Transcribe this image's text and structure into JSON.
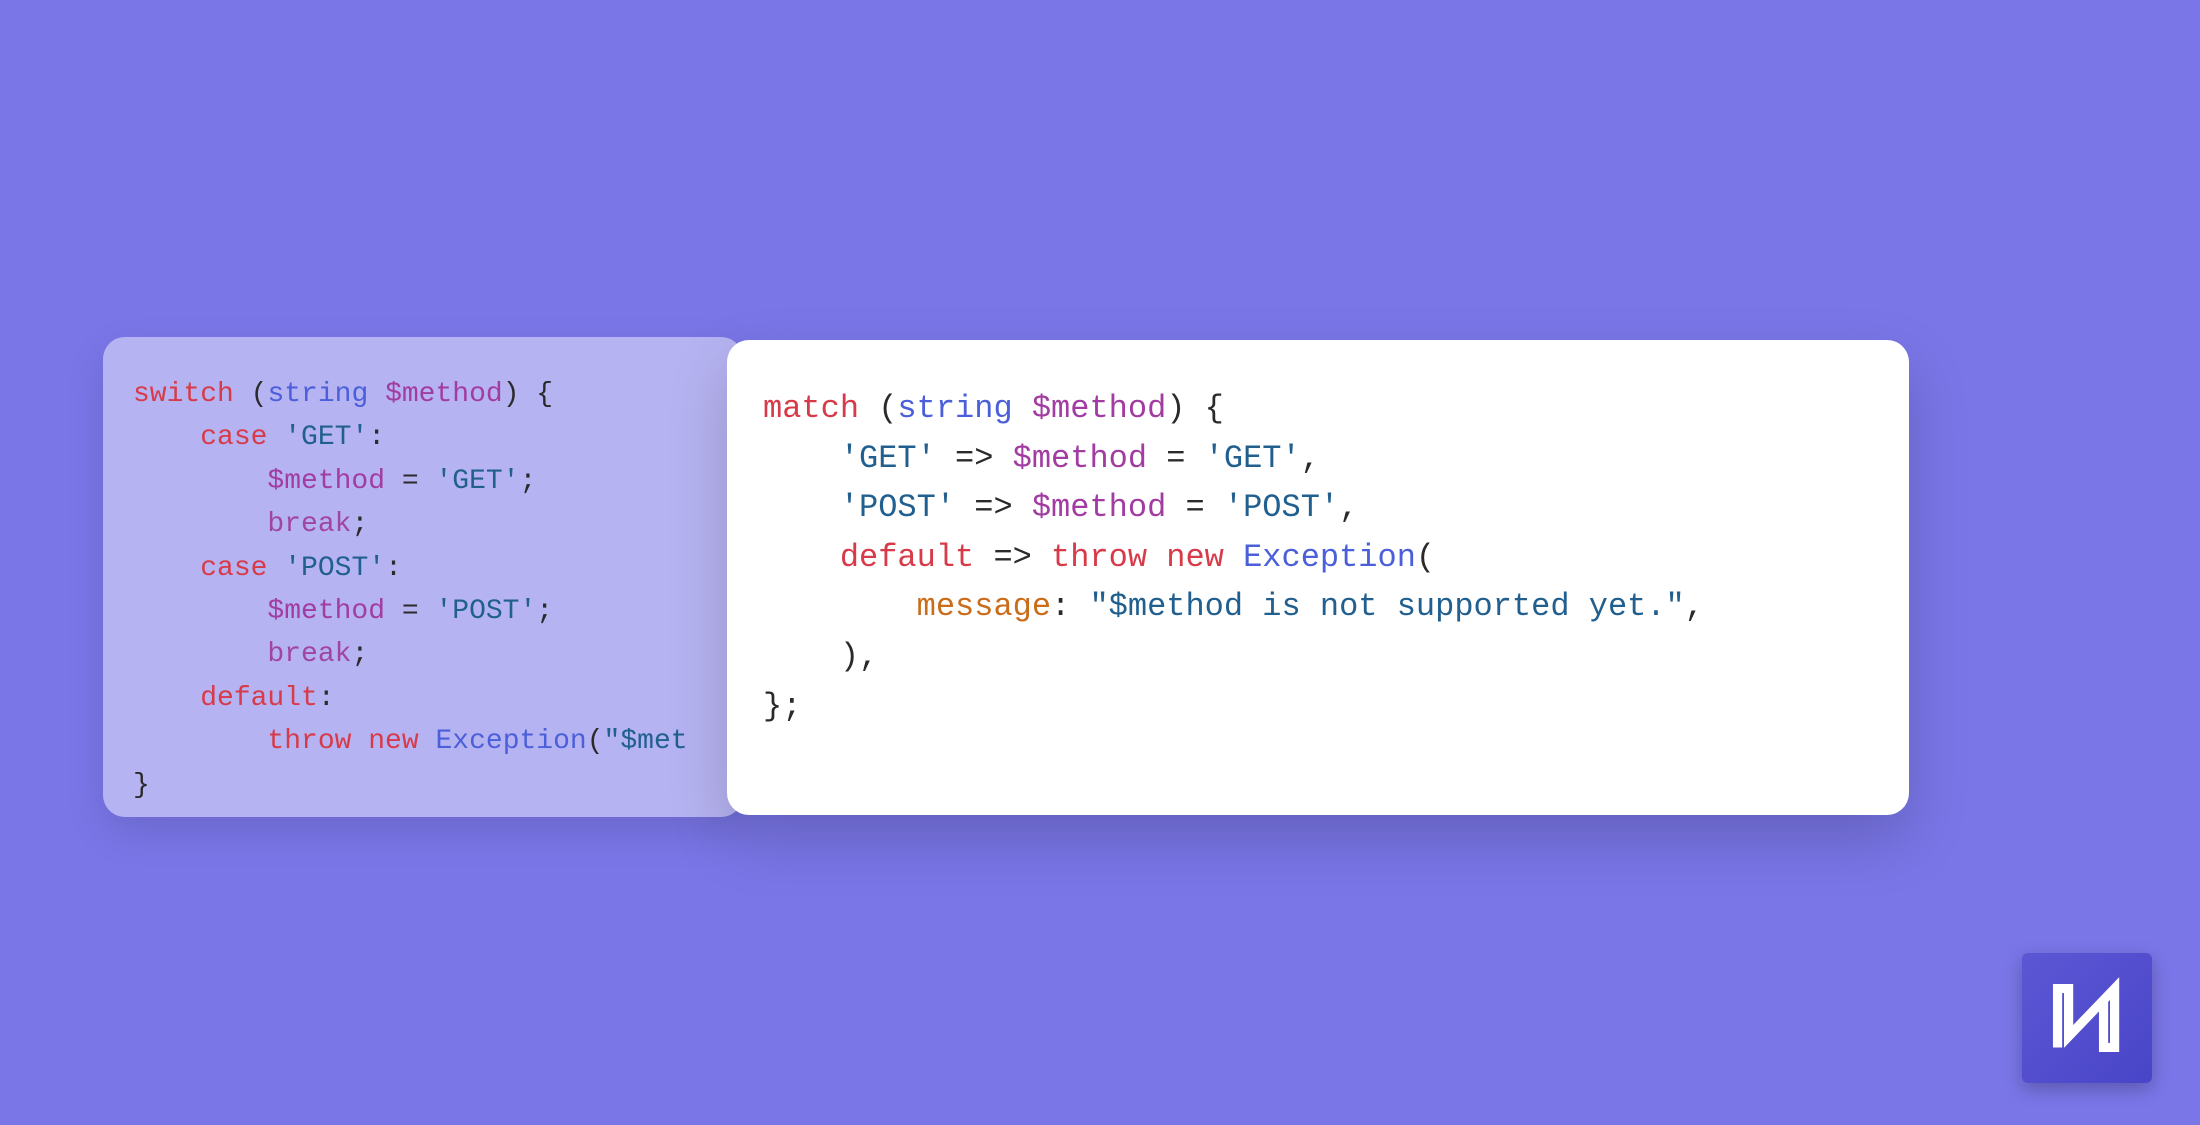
{
  "left": {
    "l1_kw": "switch",
    "l1_paren_open": " (",
    "l1_type": "string",
    "l1_sp": " ",
    "l1_var": "$method",
    "l1_paren_close": ") {",
    "l2_indent": "    ",
    "l2_kw": "case",
    "l2_sp": " ",
    "l2_str": "'GET'",
    "l2_colon": ":",
    "l3_indent": "        ",
    "l3_var": "$method",
    "l3_eq": " = ",
    "l3_str": "'GET'",
    "l3_semi": ";",
    "l4_indent": "        ",
    "l4_break": "break",
    "l4_semi": ";",
    "l5_indent": "    ",
    "l5_kw": "case",
    "l5_sp": " ",
    "l5_str": "'POST'",
    "l5_colon": ":",
    "l6_indent": "        ",
    "l6_var": "$method",
    "l6_eq": " = ",
    "l6_str": "'POST'",
    "l6_semi": ";",
    "l7_indent": "        ",
    "l7_break": "break",
    "l7_semi": ";",
    "l8_indent": "    ",
    "l8_kw": "default",
    "l8_colon": ":",
    "l9_indent": "        ",
    "l9_kw1": "throw",
    "l9_sp1": " ",
    "l9_kw2": "new",
    "l9_sp2": " ",
    "l9_exc": "Exception",
    "l9_paren": "(",
    "l9_str": "\"$met",
    "l10": "}"
  },
  "right": {
    "l1_kw": "match",
    "l1_paren_open": " (",
    "l1_type": "string",
    "l1_sp": " ",
    "l1_var": "$method",
    "l1_paren_close": ") {",
    "l2_indent": "    ",
    "l2_str1": "'GET'",
    "l2_arrow": " => ",
    "l2_var": "$method",
    "l2_eq": " = ",
    "l2_str2": "'GET'",
    "l2_comma": ",",
    "l3_indent": "    ",
    "l3_str1": "'POST'",
    "l3_arrow": " => ",
    "l3_var": "$method",
    "l3_eq": " = ",
    "l3_str2": "'POST'",
    "l3_comma": ",",
    "l4_indent": "    ",
    "l4_kw": "default",
    "l4_arrow": " => ",
    "l4_kw2": "throw",
    "l4_sp": " ",
    "l4_kw3": "new",
    "l4_sp2": " ",
    "l4_exc": "Exception",
    "l4_paren": "(",
    "l5_indent": "        ",
    "l5_named": "message",
    "l5_colon": ": ",
    "l5_str": "\"$method is not supported yet.\"",
    "l5_comma": ",",
    "l6_indent": "    )",
    "l6_comma": ",",
    "l7": "};"
  }
}
